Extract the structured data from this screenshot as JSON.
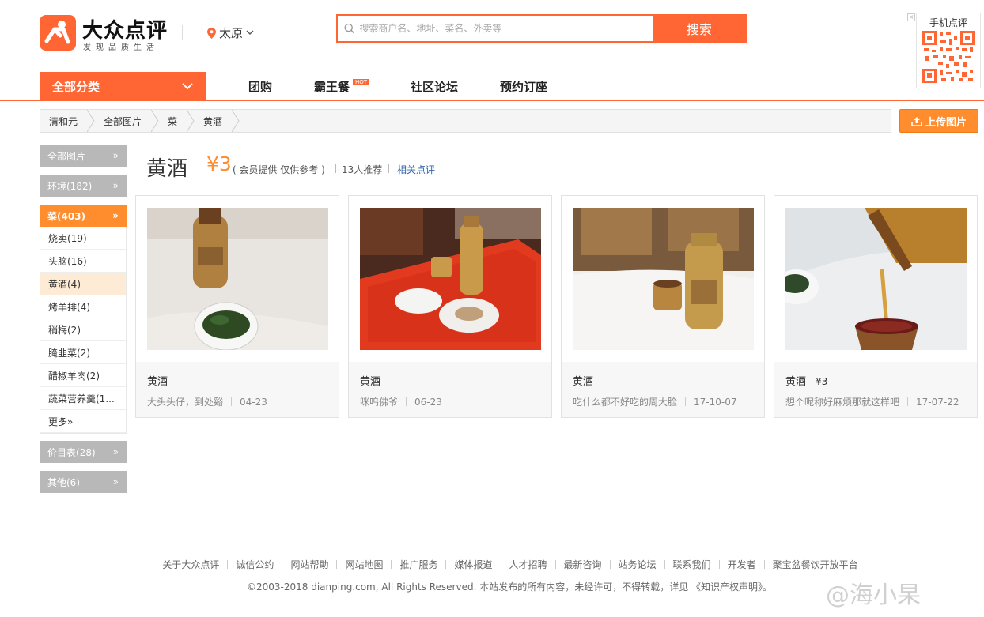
{
  "header": {
    "logo_name": "大众点评",
    "logo_slogan": "发现品质生活",
    "city": "太原",
    "search": {
      "placeholder": "搜索商户名、地址、菜名、外卖等",
      "button_label": "搜索"
    },
    "qr_title": "手机点评"
  },
  "nav": {
    "all_categories": "全部分类",
    "items": [
      {
        "label": "团购"
      },
      {
        "label": "霸王餐",
        "badge": "HOT"
      },
      {
        "label": "社区论坛"
      },
      {
        "label": "预约订座"
      }
    ]
  },
  "breadcrumb": [
    "清和元",
    "全部图片",
    "菜",
    "黄酒"
  ],
  "upload_button": "上传图片",
  "sidebar": {
    "heads": [
      {
        "label": "全部图片",
        "arrow": "»"
      },
      {
        "label": "环境(182)",
        "arrow": "»"
      },
      {
        "label": "菜(403)",
        "arrow": "»"
      }
    ],
    "items": [
      "烧卖(19)",
      "头脑(16)",
      "黄酒(4)",
      "烤羊排(4)",
      "稍梅(2)",
      "腌韭菜(2)",
      "醋椒羊肉(2)",
      "蔬菜营养羹(1...",
      "更多»"
    ],
    "selected_index": 2,
    "bottom_heads": [
      {
        "label": "价目表(28)",
        "arrow": "»"
      },
      {
        "label": "其他(6)",
        "arrow": "»"
      }
    ]
  },
  "dish": {
    "title": "黄酒",
    "price": "¥3",
    "price_note": "( 会员提供 仅供参考 )",
    "recommend": "13人推荐",
    "related": "相关点评"
  },
  "photos": [
    {
      "title": "黄酒",
      "price": "",
      "user": "大头头仔，到处谿",
      "date": "04-23",
      "scene": "bottle-greens"
    },
    {
      "title": "黄酒",
      "price": "",
      "user": "咪呜佛爷",
      "date": "06-23",
      "scene": "red-tray"
    },
    {
      "title": "黄酒",
      "price": "",
      "user": "吃什么都不好吃的周大脸",
      "date": "17-10-07",
      "scene": "bottle-cup"
    },
    {
      "title": "黄酒",
      "price": "¥3",
      "user": "想个昵称好麻烦那就这样吧",
      "date": "17-07-22",
      "scene": "pouring"
    }
  ],
  "footer": {
    "links": [
      "关于大众点评",
      "诚信公约",
      "网站帮助",
      "网站地图",
      "推广服务",
      "媒体报道",
      "人才招聘",
      "最新咨询",
      "站务论坛",
      "联系我们",
      "开发者",
      "聚宝盆餐饮开放平台"
    ],
    "copyright": "©2003-2018 dianping.com, All Rights Reserved.    本站发布的所有内容，未经许可，不得转载，详见 《知识产权声明》。"
  },
  "watermark": "@海小杲",
  "colors": {
    "brand": "#ff6633",
    "accent": "#ff8d2e",
    "link": "#3366aa",
    "sidebar_gray": "#b8b8b8"
  }
}
